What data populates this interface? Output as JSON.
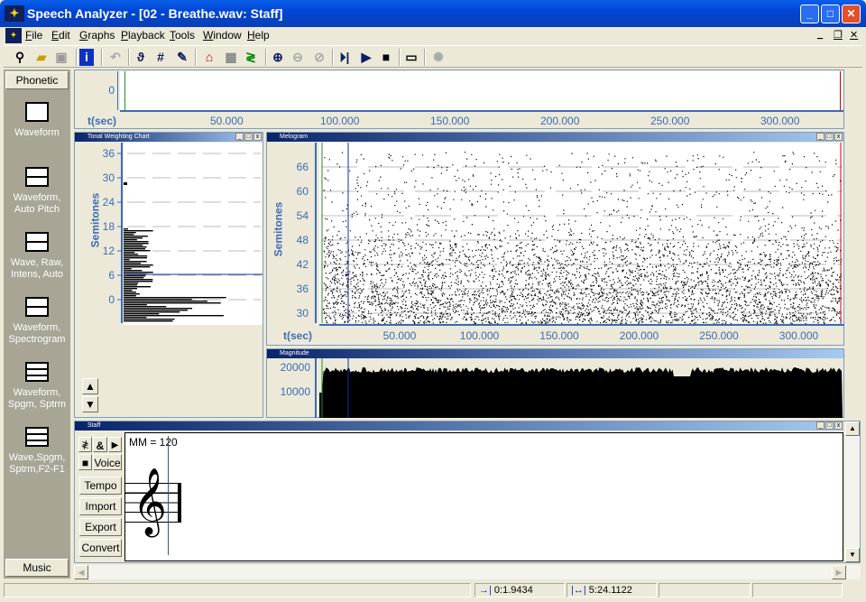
{
  "window": {
    "title": "Speech Analyzer - [02 - Breathe.wav: Staff]",
    "logo": "speech-analyzer-logo"
  },
  "menu": [
    "File",
    "Edit",
    "Graphs",
    "Playback",
    "Tools",
    "Window",
    "Help"
  ],
  "toolbar": [
    "microphone-icon",
    "open-folder-icon",
    "save-icon",
    "info-icon",
    "undo-icon",
    "add-phonetic-icon",
    "add-sharp-icon",
    "edit-pencil-icon",
    "graph-icon",
    "spectrogram-icon",
    "formant-icon",
    "zoom-in-icon",
    "zoom-out-icon",
    "zoom-full-icon",
    "play-to-cursor-icon",
    "play-icon",
    "stop-icon",
    "player-icon",
    "waveform-gen-icon"
  ],
  "sidebar": {
    "top": "Phonetic",
    "items": [
      "Waveform",
      "Waveform, Auto Pitch",
      "Wave, Raw, Intens, Auto",
      "Waveform, Spectrogram",
      "Waveform, Spgm, Sptrm",
      "Wave,Spgm, Sptrm,F2-F1"
    ],
    "bottom": "Music"
  },
  "waveform": {
    "y_tick": "0",
    "x_label": "t(sec)",
    "x_ticks": [
      "50.000",
      "100.000",
      "150.000",
      "200.000",
      "250.000",
      "300.000"
    ]
  },
  "tonal": {
    "title": "Tonal Weighting Chart",
    "y_label": "Semitones",
    "y_ticks": [
      "36",
      "30",
      "24",
      "18",
      "12",
      "6",
      "0"
    ]
  },
  "melogram": {
    "title": "Melogram",
    "y_label": "Semitones",
    "y_ticks": [
      "66",
      "60",
      "54",
      "48",
      "42",
      "36",
      "30"
    ],
    "x_label": "t(sec)",
    "x_ticks": [
      "50.000",
      "100.000",
      "150.000",
      "200.000",
      "250.000",
      "300.000"
    ]
  },
  "magnitude": {
    "title": "Magnitude",
    "y_ticks": [
      "20000",
      "10000"
    ]
  },
  "staff": {
    "title": "Staff",
    "tempo_text": "MM = 120",
    "buttons": {
      "voice": "Voice",
      "tempo": "Tempo",
      "import": "Import",
      "export": "Export",
      "convert": "Convert"
    },
    "tool_icons": [
      "note-input-icon",
      "ampersand-icon",
      "play-icon",
      "stop-icon"
    ]
  },
  "status": {
    "cursor_position": "0:1.9434",
    "duration": "5:24.1122"
  }
}
